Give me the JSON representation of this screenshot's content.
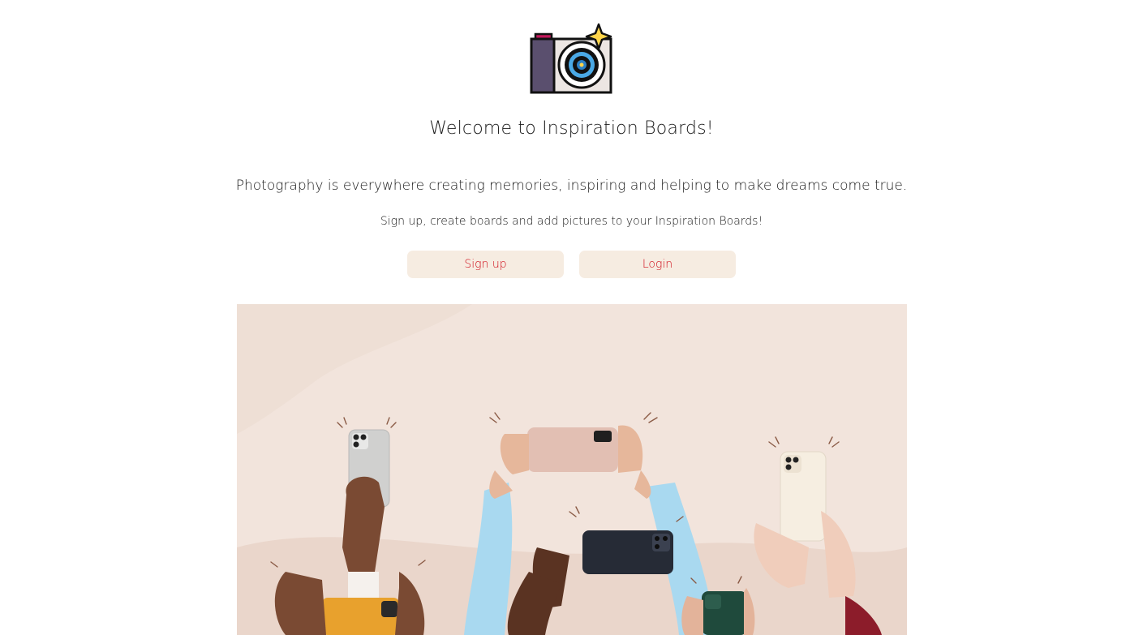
{
  "logo": {
    "icon": "camera-icon"
  },
  "title": "Welcome to Inspiration Boards!",
  "tagline": "Photography is everywhere creating memories, inspiring and helping to make dreams come true.",
  "subline": "Sign up, create boards and add pictures to your Inspiration Boards!",
  "buttons": {
    "signup": "Sign up",
    "login": "Login"
  },
  "colors": {
    "button_bg": "#f6ece1",
    "button_text": "#d0101c",
    "hero_bg": "#f2e4dc"
  },
  "hero": {
    "image": "hands-holding-smartphones-image"
  }
}
